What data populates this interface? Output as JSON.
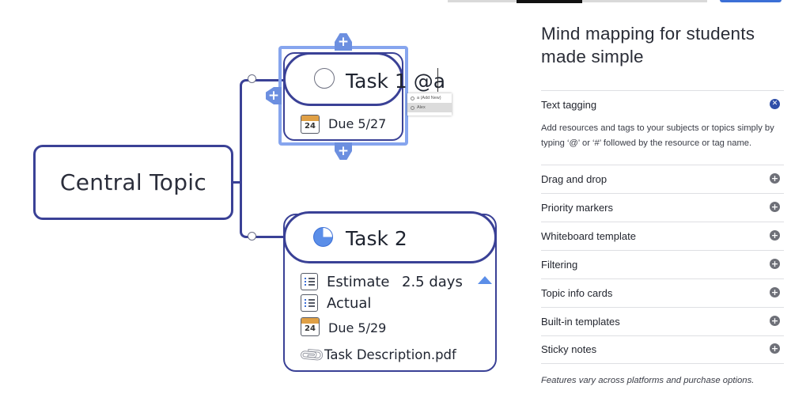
{
  "mindmap": {
    "central_topic": "Central Topic",
    "task1": {
      "title": "Task 1 @a",
      "due": "Due 5/27",
      "calendar_day": "24",
      "suggestions": [
        "a (Add New)",
        "Alex"
      ]
    },
    "task2": {
      "title": "Task 2",
      "estimate_label": "Estimate",
      "estimate_value": "2.5 days",
      "actual_label": "Actual",
      "due": "Due 5/29",
      "calendar_day": "24",
      "attachment": "Task Description.pdf"
    }
  },
  "panel": {
    "title": "Mind mapping for students made simple",
    "accordion": [
      {
        "label": "Text tagging",
        "expanded": true,
        "icon": "close-icon"
      },
      {
        "label": "Drag and drop",
        "expanded": false,
        "icon": "plus-icon"
      },
      {
        "label": "Priority markers",
        "expanded": false,
        "icon": "plus-icon"
      },
      {
        "label": "Whiteboard template",
        "expanded": false,
        "icon": "plus-icon"
      },
      {
        "label": "Filtering",
        "expanded": false,
        "icon": "plus-icon"
      },
      {
        "label": "Topic info cards",
        "expanded": false,
        "icon": "plus-icon"
      },
      {
        "label": "Built-in templates",
        "expanded": false,
        "icon": "plus-icon"
      },
      {
        "label": "Sticky notes",
        "expanded": false,
        "icon": "plus-icon"
      }
    ],
    "expanded_description": "Add resources and tags to your subjects or topics simply by typing ‘@’ or ‘#’ followed by the resource or tag name.",
    "footnote": "Features vary across platforms and purchase options."
  },
  "colors": {
    "node_border": "#3a4196",
    "selection": "#86a5ee",
    "accent_blue": "#5b8ee8",
    "calendar_band": "#e0a045",
    "close_button": "#2f4ea8"
  }
}
